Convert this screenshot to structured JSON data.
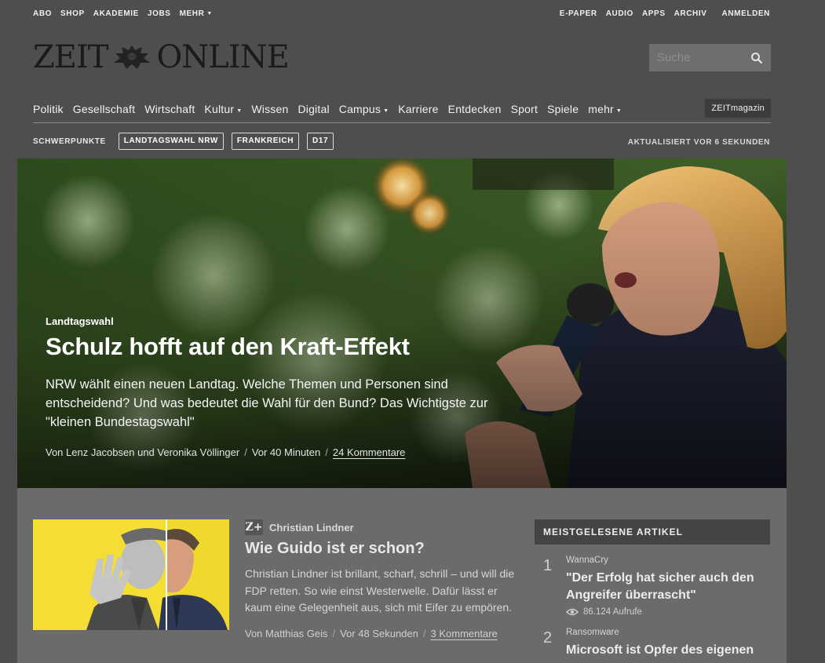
{
  "topbar": {
    "left": [
      "ABO",
      "SHOP",
      "AKADEMIE",
      "JOBS",
      "MEHR"
    ],
    "right": [
      "E-PAPER",
      "AUDIO",
      "APPS",
      "ARCHIV"
    ],
    "login": "ANMELDEN"
  },
  "logo": {
    "left": "ZEIT",
    "right": "ONLINE"
  },
  "search": {
    "placeholder": "Suche"
  },
  "nav": {
    "items": [
      "Politik",
      "Gesellschaft",
      "Wirtschaft",
      "Kultur",
      "Wissen",
      "Digital",
      "Campus",
      "Karriere",
      "Entdecken",
      "Sport",
      "Spiele",
      "mehr"
    ],
    "magazine": "ZEITmagazin"
  },
  "schwerpunkte": {
    "label": "SCHWERPUNKTE",
    "chips": [
      "LANDTAGSWAHL NRW",
      "FRANKREICH",
      "D17"
    ],
    "updated": "AKTUALISIERT VOR 6 SEKUNDEN"
  },
  "hero": {
    "kicker": "Landtagswahl",
    "title": "Schulz hofft auf den Kraft-Effekt",
    "lead": "NRW wählt einen neuen Landtag. Welche Themen und Personen sind entscheidend? Und was bedeutet die Wahl für den Bund? Das Wichtigste zur \"kleinen Bundestagswahl\"",
    "author": "Von Lenz Jacobsen und Veronika Völlinger",
    "time": "Vor 40 Minuten",
    "comments": "24 Kommentare"
  },
  "teaser": {
    "badge": "Z+",
    "kicker": "Christian Lindner",
    "title": "Wie Guido ist er schon?",
    "text": "Christian Lindner ist brillant, scharf, schrill – und will die FDP retten. So wie einst Westerwelle. Dafür lässt er kaum eine Gelegenheit aus, sich mit Eifer zu empören.",
    "author": "Von Matthias Geis",
    "time": "Vor 48 Sekunden",
    "comments": "3 Kommentare"
  },
  "mostread": {
    "heading": "MEISTGELESENE ARTIKEL",
    "items": [
      {
        "num": "1",
        "cat": "WannaCry",
        "title": "\"Der Erfolg hat sicher auch den Angreifer überrascht\"",
        "views": "86.124 Aufrufe"
      },
      {
        "num": "2",
        "cat": "Ransomware",
        "title": "Microsoft ist Opfer des eigenen",
        "views": ""
      }
    ]
  },
  "icons": {
    "search": "search-icon",
    "caret": "caret-down-icon",
    "views": "eye-icon",
    "emblem": "eagle-emblem-icon"
  }
}
